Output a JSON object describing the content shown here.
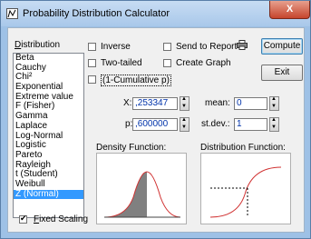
{
  "window": {
    "title": "Probability Distribution Calculator",
    "close_glyph": "X"
  },
  "distribution": {
    "label": "Distribution",
    "items": [
      "Beta",
      "Cauchy",
      "Chi²",
      "Exponential",
      "Extreme value",
      "F (Fisher)",
      "Gamma",
      "Laplace",
      "Log-Normal",
      "Logistic",
      "Pareto",
      "Rayleigh",
      "t (Student)",
      "Weibull",
      "Z (Normal)"
    ],
    "selected": "Z (Normal)"
  },
  "options": {
    "inverse": "Inverse",
    "two_tailed": "Two-tailed",
    "cumulative": "(1-Cumulative p)",
    "send_to_report": "Send to Report",
    "create_graph": "Create Graph"
  },
  "buttons": {
    "compute": "Compute",
    "exit": "Exit"
  },
  "fields": {
    "x_label": "X:",
    "x_value": ",253347",
    "p_label": "p:",
    "p_value": ",600000",
    "mean_label": "mean:",
    "mean_value": "0",
    "sd_label": "st.dev.:",
    "sd_value": "1"
  },
  "panels": {
    "density": "Density Function:",
    "distribution": "Distribution Function:"
  },
  "fixed_scaling": {
    "label": "Fixed Scaling",
    "checked": true
  }
}
